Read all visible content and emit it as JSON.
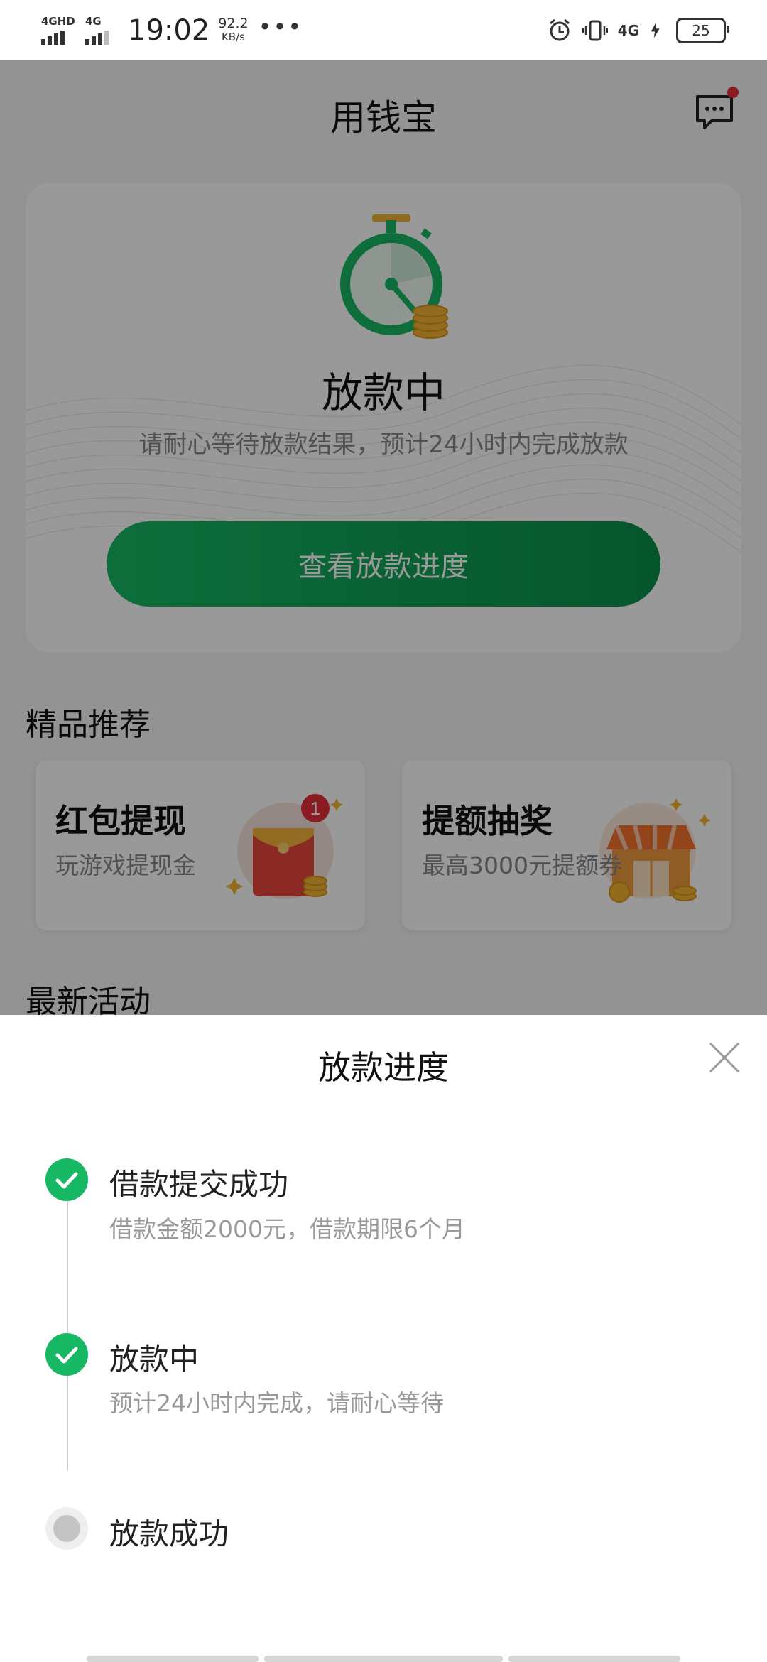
{
  "status_bar": {
    "signal1_label": "4GHD",
    "signal2_label": "4G",
    "time": "19:02",
    "speed_value": "92.2",
    "speed_unit": "KB/s",
    "more": "•••",
    "net_label": "4G",
    "battery": "25"
  },
  "header": {
    "title": "用钱宝"
  },
  "loan_status": {
    "title": "放款中",
    "description": "请耐心等待放款结果，预计24小时内完成放款",
    "button_label": "查看放款进度"
  },
  "recommend": {
    "section_title": "精品推荐",
    "cards": [
      {
        "title": "红包提现",
        "subtitle": "玩游戏提现金",
        "badge": "1"
      },
      {
        "title": "提额抽奖",
        "subtitle": "最高3000元提额券"
      }
    ]
  },
  "activities": {
    "section_title": "最新活动"
  },
  "progress_sheet": {
    "title": "放款进度",
    "steps": [
      {
        "title": "借款提交成功",
        "subtitle": "借款金额2000元，借款期限6个月",
        "state": "done"
      },
      {
        "title": "放款中",
        "subtitle": "预计24小时内完成，请耐心等待",
        "state": "done"
      },
      {
        "title": "放款成功",
        "subtitle": "",
        "state": "pending"
      }
    ]
  },
  "colors": {
    "accent": "#17b864",
    "accent_dark": "#0a8f4a",
    "badge_red": "#e5303a",
    "pending_grey": "#c4c4c4"
  }
}
